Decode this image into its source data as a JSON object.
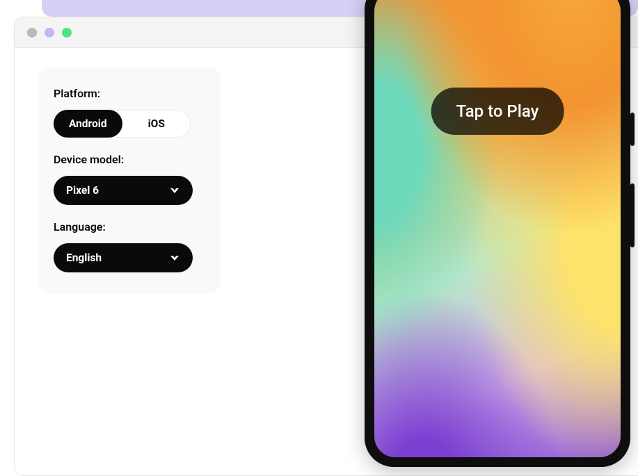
{
  "panel": {
    "platform_label": "Platform:",
    "platform_options": {
      "android": "Android",
      "ios": "iOS"
    },
    "platform_selected": "android",
    "device_label": "Device model:",
    "device_selected": "Pixel 6",
    "language_label": "Language:",
    "language_selected": "English"
  },
  "phone": {
    "play_label": "Tap to Play"
  }
}
